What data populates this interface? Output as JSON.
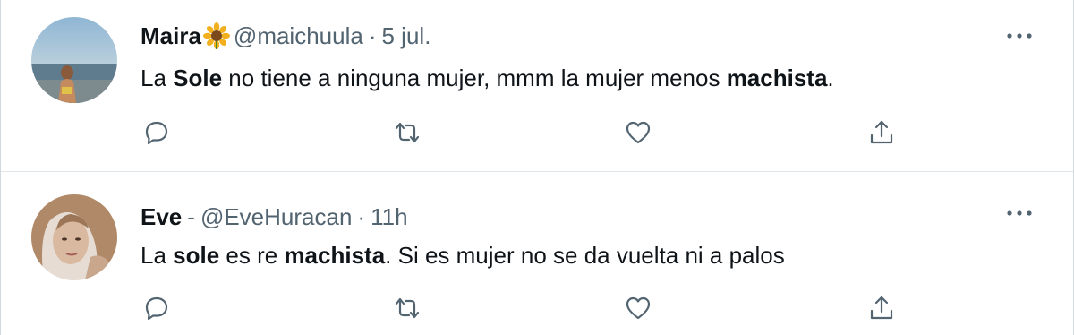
{
  "tweets": [
    {
      "name": "Maira",
      "emoji": "sunflower-emoji",
      "handle": "@maichuula",
      "dot": "·",
      "time": "5 jul.",
      "text_parts": [
        "La ",
        "Sole",
        " no tiene a ninguna mujer, mmm la mujer menos ",
        "machista",
        "."
      ]
    },
    {
      "name": "Eve",
      "name_sep": "-",
      "handle": "@EveHuracan",
      "dot": "·",
      "time": "11h",
      "text_parts": [
        "La ",
        "sole",
        " es re ",
        "machista",
        ". Si es mujer no se da vuelta ni a palos"
      ]
    }
  ],
  "icons": {
    "more": "more-horizontal-icon",
    "reply": "reply-icon",
    "retweet": "retweet-icon",
    "like": "heart-icon",
    "share": "share-icon"
  },
  "colors": {
    "text": "#0f1419",
    "secondary": "#536471",
    "divider": "#dfe5e8"
  }
}
